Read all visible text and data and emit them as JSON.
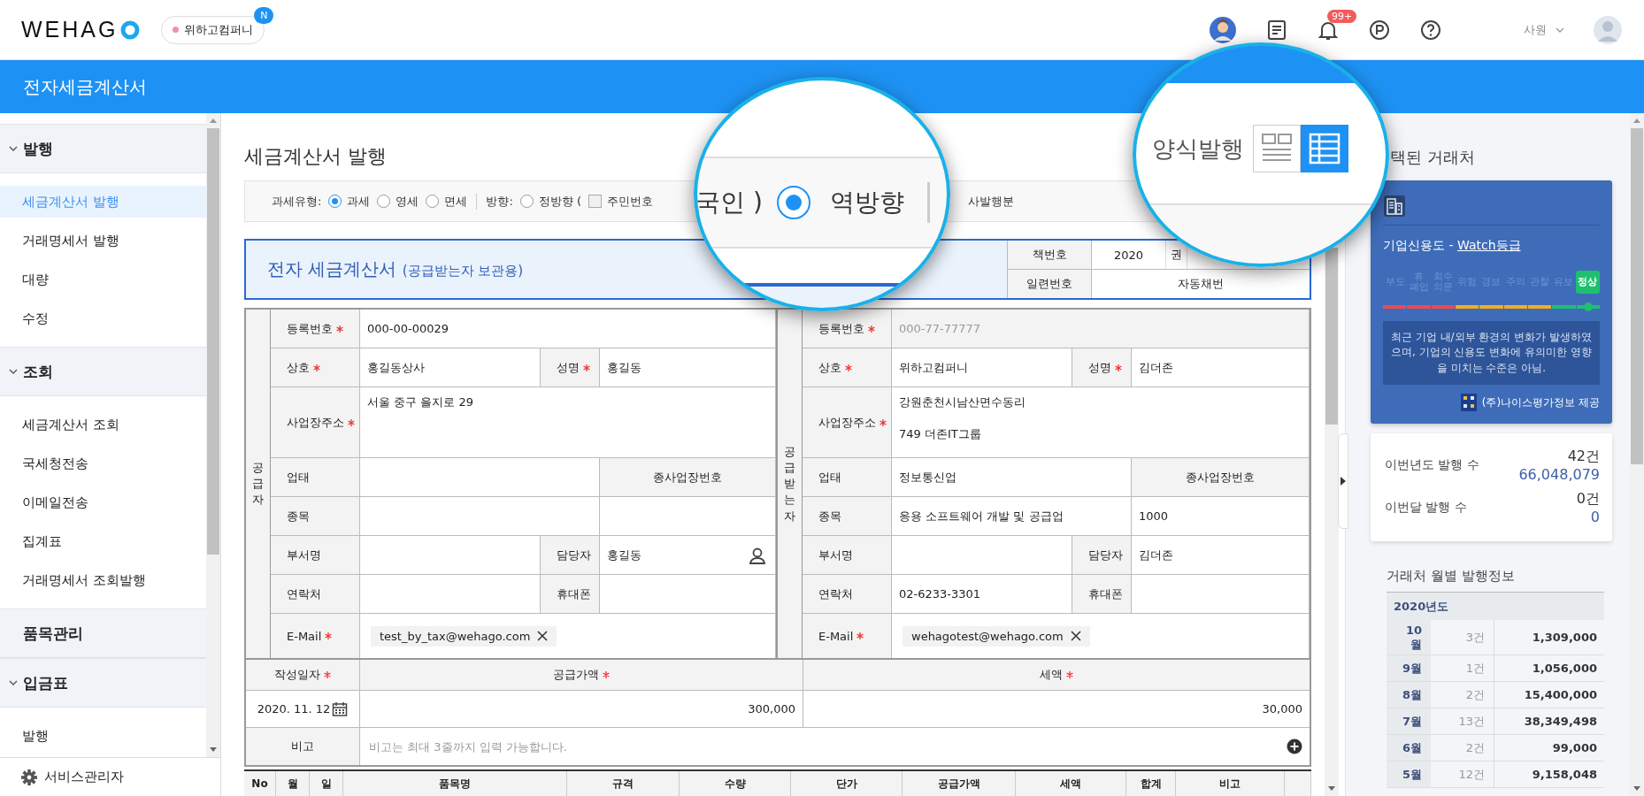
{
  "header": {
    "logo": "WEHAG",
    "company": {
      "name": "위하고컴퍼니",
      "badge": "N"
    },
    "notification_count": "99+",
    "user_role": "사원"
  },
  "app_title": "전자세금계산서",
  "sidebar": {
    "groups": [
      {
        "kind": "group",
        "label": "발행",
        "expanded": true,
        "items": [
          {
            "label": "세금계산서 발행",
            "selected": true
          },
          {
            "label": "거래명세서 발행",
            "selected": false
          },
          {
            "label": "대량",
            "selected": false
          },
          {
            "label": "수정",
            "selected": false
          }
        ]
      },
      {
        "kind": "group",
        "label": "조회",
        "expanded": true,
        "items": [
          {
            "label": "세금계산서 조회",
            "selected": false
          },
          {
            "label": "국세청전송",
            "selected": false
          },
          {
            "label": "이메일전송",
            "selected": false
          },
          {
            "label": "집계표",
            "selected": false
          },
          {
            "label": "거래명세서 조회발행",
            "selected": false
          }
        ]
      },
      {
        "kind": "link",
        "label": "품목관리"
      },
      {
        "kind": "group",
        "label": "입금표",
        "expanded": true,
        "items": [
          {
            "label": "발행",
            "selected": false
          }
        ]
      }
    ],
    "footer": "서비스관리자"
  },
  "page_title": "세금계산서 발행",
  "options": [
    {
      "kind": "label",
      "text": "과세유형:"
    },
    {
      "kind": "radio",
      "text": "과세",
      "selected": true
    },
    {
      "kind": "radio",
      "text": "영세",
      "selected": false
    },
    {
      "kind": "radio",
      "text": "면세",
      "selected": false
    },
    {
      "kind": "divider"
    },
    {
      "kind": "label",
      "text": "방향:"
    },
    {
      "kind": "radio",
      "text": "정방향 (",
      "selected": false
    },
    {
      "kind": "checkbox",
      "text": "주민번호",
      "checked": false
    },
    {
      "kind": "hidden"
    },
    {
      "kind": "label",
      "text": "사발행분"
    }
  ],
  "invoice": {
    "title": "전자 세금계산서",
    "subtitle": "(공급받는자 보관용)",
    "book": [
      {
        "label": "책번호",
        "value": "2020",
        "unit": "권"
      },
      {
        "label": "일련번호",
        "value": "자동채번"
      }
    ],
    "parties": [
      {
        "side_label": "공급자",
        "rows": [
          {
            "kind": "single",
            "cells": [
              {
                "kind": "label",
                "text": "등록번호",
                "required": true
              },
              {
                "kind": "value",
                "value": "000-00-00029"
              }
            ]
          },
          {
            "kind": "pair",
            "cells": [
              {
                "kind": "label",
                "text": "상호",
                "required": true
              },
              {
                "kind": "value",
                "value": "홍길동상사"
              },
              {
                "kind": "label",
                "text": "성명",
                "required": true
              },
              {
                "kind": "value",
                "value": "홍길동"
              }
            ]
          },
          {
            "kind": "address",
            "cells": [
              {
                "kind": "label",
                "text": "사업장주소",
                "required": true
              },
              {
                "kind": "address",
                "lines": [
                  "서울 중구 을지로 29"
                ]
              }
            ]
          },
          {
            "kind": "split",
            "cells": [
              {
                "kind": "label",
                "text": "업태"
              },
              {
                "kind": "value"
              },
              {
                "kind": "merged"
              },
              {
                "kind": "heading",
                "text": "종사업장번호"
              }
            ]
          },
          {
            "kind": "split",
            "cells": [
              {
                "kind": "label",
                "text": "종목"
              },
              {
                "kind": "value"
              },
              {
                "kind": "merged"
              },
              {
                "kind": "value"
              }
            ]
          },
          {
            "kind": "pair",
            "cells": [
              {
                "kind": "label",
                "text": "부서명"
              },
              {
                "kind": "value"
              },
              {
                "kind": "label",
                "text": "담당자"
              },
              {
                "kind": "value",
                "value": "홍길동",
                "lookup": true
              }
            ]
          },
          {
            "kind": "pair",
            "cells": [
              {
                "kind": "label",
                "text": "연락처"
              },
              {
                "kind": "value"
              },
              {
                "kind": "label",
                "text": "휴대폰"
              },
              {
                "kind": "value"
              }
            ]
          },
          {
            "kind": "email",
            "cells": [
              {
                "kind": "label",
                "text": "E-Mail",
                "required": true
              },
              {
                "kind": "email",
                "chip": "test_by_tax@wehago.com"
              }
            ]
          }
        ]
      },
      {
        "side_label": "공급받는자",
        "rows": [
          {
            "kind": "single",
            "cells": [
              {
                "kind": "label",
                "text": "등록번호",
                "required": true
              },
              {
                "kind": "value",
                "value": "000-77-77777",
                "disabled": true
              }
            ]
          },
          {
            "kind": "pair",
            "cells": [
              {
                "kind": "label",
                "text": "상호",
                "required": true
              },
              {
                "kind": "value",
                "value": "위하고컴퍼니"
              },
              {
                "kind": "label",
                "text": "성명",
                "required": true
              },
              {
                "kind": "value",
                "value": "김더존"
              }
            ]
          },
          {
            "kind": "address",
            "cells": [
              {
                "kind": "label",
                "text": "사업장주소",
                "required": true
              },
              {
                "kind": "address",
                "lines": [
                  "강원춘천시남산면수동리",
                  "749 더존IT그룹"
                ]
              }
            ]
          },
          {
            "kind": "split",
            "cells": [
              {
                "kind": "label",
                "text": "업태"
              },
              {
                "kind": "value",
                "value": "정보통신업"
              },
              {
                "kind": "merged"
              },
              {
                "kind": "heading",
                "text": "종사업장번호"
              }
            ]
          },
          {
            "kind": "split",
            "cells": [
              {
                "kind": "label",
                "text": "종목"
              },
              {
                "kind": "value",
                "value": "응용 소프트웨어 개발 및 공급업"
              },
              {
                "kind": "merged"
              },
              {
                "kind": "value",
                "value": "1000"
              }
            ]
          },
          {
            "kind": "pair",
            "cells": [
              {
                "kind": "label",
                "text": "부서명"
              },
              {
                "kind": "value"
              },
              {
                "kind": "label",
                "text": "담당자"
              },
              {
                "kind": "value",
                "value": "김더존"
              }
            ]
          },
          {
            "kind": "pair",
            "cells": [
              {
                "kind": "label",
                "text": "연락처"
              },
              {
                "kind": "value",
                "value": "02-6233-3301"
              },
              {
                "kind": "label",
                "text": "휴대폰"
              },
              {
                "kind": "value"
              }
            ]
          },
          {
            "kind": "email",
            "cells": [
              {
                "kind": "label",
                "text": "E-Mail",
                "required": true
              },
              {
                "kind": "email",
                "chip": "wehagotest@wehago.com"
              }
            ]
          }
        ]
      }
    ],
    "amounts": {
      "headings": [
        {
          "text": "작성일자",
          "required": true
        },
        {
          "text": "공급가액",
          "required": true
        },
        {
          "text": "세액",
          "required": true
        }
      ],
      "date": "2020. 11. 12",
      "supply": "300,000",
      "tax": "30,000"
    },
    "note": {
      "label": "비고",
      "placeholder": "비고는 최대 3줄까지 입력 가능합니다."
    },
    "item_columns": [
      "No",
      "월",
      "일",
      "품목명",
      "규격",
      "수량",
      "단가",
      "공급가액",
      "세액",
      "합계",
      "비고"
    ]
  },
  "magnifiers": [
    {
      "kind": "options",
      "items": [
        {
          "kind": "label",
          "text": "국인 )"
        },
        {
          "kind": "radio",
          "text": "역방향",
          "selected": true
        },
        {
          "kind": "divider"
        }
      ]
    },
    {
      "kind": "view-toggle",
      "label": "양식발행",
      "buttons": [
        {
          "kind": "form",
          "selected": false
        },
        {
          "kind": "grid",
          "selected": true
        }
      ]
    }
  ],
  "panel": {
    "title": "택된 거래처",
    "credit": {
      "title": "기업신용도 - ",
      "grade_link": "Watch등급",
      "grades": [
        {
          "text": "부도",
          "color": "#f0484e",
          "selected": false
        },
        {
          "text": "휴 폐업",
          "color": "#f0484e",
          "selected": false
        },
        {
          "text": "회수 의문",
          "color": "#f0484e",
          "selected": false
        },
        {
          "text": "위험",
          "color": "#f5ad1b",
          "selected": false
        },
        {
          "text": "경보",
          "color": "#f5ad1b",
          "selected": false
        },
        {
          "text": "주의",
          "color": "#f5ad1b",
          "selected": false
        },
        {
          "text": "관찰",
          "color": "#f5ad1b",
          "selected": false
        },
        {
          "text": "유보",
          "color": "#1fbf6f",
          "selected": false
        },
        {
          "text": "정상",
          "color": "#1fbf6f",
          "selected": true
        }
      ],
      "message": "최근 기업 내/외부 환경의 변화가 발생하였으며, 기업의 신용도 변화에 유의미한 영향을 미치는 수준은 아님.",
      "provider": "(주)나이스평가정보 제공"
    },
    "stats": [
      {
        "label": "이번년도 발행 수",
        "count": "42건",
        "amount": "66,048,079"
      },
      {
        "label": "이번달 발행 수",
        "count": "0건",
        "amount": "0"
      }
    ],
    "monthly": {
      "title": "거래처 월별 발행정보",
      "year": "2020년도",
      "rows": [
        {
          "month": "10월",
          "count": "3건",
          "amount": "1,309,000"
        },
        {
          "month": "9월",
          "count": "1건",
          "amount": "1,056,000"
        },
        {
          "month": "8월",
          "count": "2건",
          "amount": "15,400,000"
        },
        {
          "month": "7월",
          "count": "13건",
          "amount": "38,349,498"
        },
        {
          "month": "6월",
          "count": "2건",
          "amount": "99,000"
        },
        {
          "month": "5월",
          "count": "12건",
          "amount": "9,158,048"
        }
      ]
    }
  }
}
